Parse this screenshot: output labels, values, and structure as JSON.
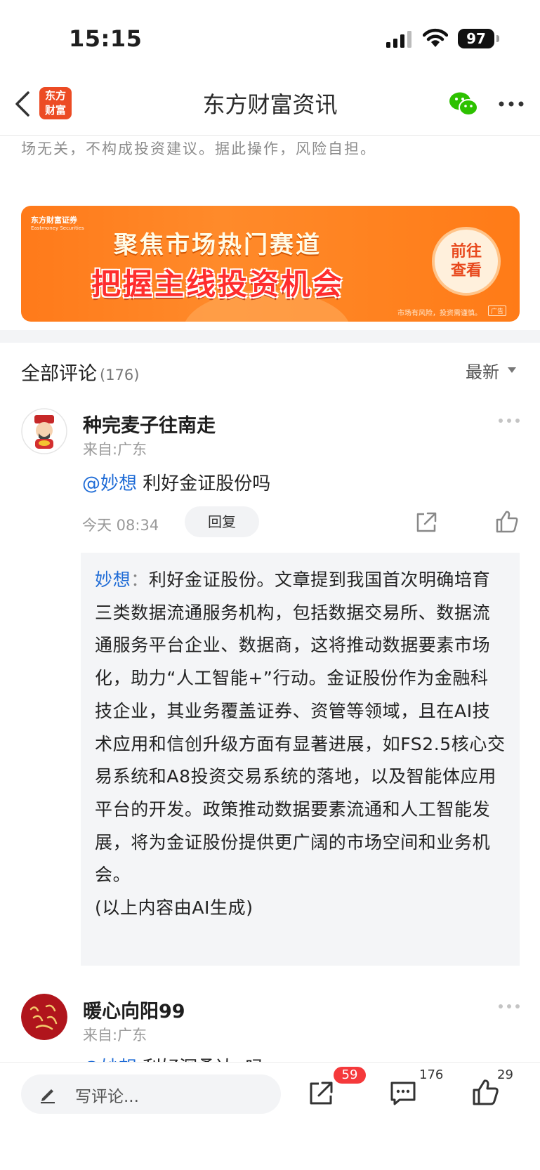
{
  "status_bar": {
    "time": "15:15",
    "battery": "97"
  },
  "nav": {
    "logo_line1": "东方",
    "logo_line2": "财富",
    "title": "东方财富资讯"
  },
  "article": {
    "disclaimer_tail": "场无关，不构成投资建议。据此操作，风险自担。"
  },
  "banner": {
    "brand": "东方财富证券",
    "brand_en": "Eastmoney Securities",
    "line1": "聚焦市场热门赛道",
    "line2": "把握主线投资机会",
    "cta_line1": "前往",
    "cta_line2": "查看",
    "risk": "市场有风险，投资需谨慎。",
    "ad_tag": "广告"
  },
  "comments_header": {
    "title": "全部评论",
    "count": "(176)",
    "sort": "最新"
  },
  "comments": [
    {
      "username": "种完麦子往南走",
      "location": "来自:广东",
      "mention": "@妙想",
      "text": " 利好金证股份吗",
      "time": "今天 08:34",
      "reply_label": "回复",
      "quote_name": "妙想",
      "quote_sep": "：",
      "quote_text": "利好金证股份。文章提到我国首次明确培育三类数据流通服务机构，包括数据交易所、数据流通服务平台企业、数据商，这将推动数据要素市场化，助力“人工智能+”行动。金证股份作为金融科技企业，其业务覆盖证券、资管等领域，且在AI技术应用和信创升级方面有显著进展，如FS2.5核心交易系统和A8投资交易系统的落地，以及智能体应用平台的开发。政策推动数据要素流通和人工智能发展，将为金证股份提供更广阔的市场空间和业务机会。",
      "quote_footer": "(以上内容由AI生成)"
    },
    {
      "username": "暖心向阳99",
      "location": "来自:广东",
      "mention": "@妙想",
      "text": " 利好深桑达a吗"
    }
  ],
  "bottom_bar": {
    "placeholder": "写评论...",
    "share_badge": "59",
    "comment_count": "176",
    "like_count": "29"
  }
}
